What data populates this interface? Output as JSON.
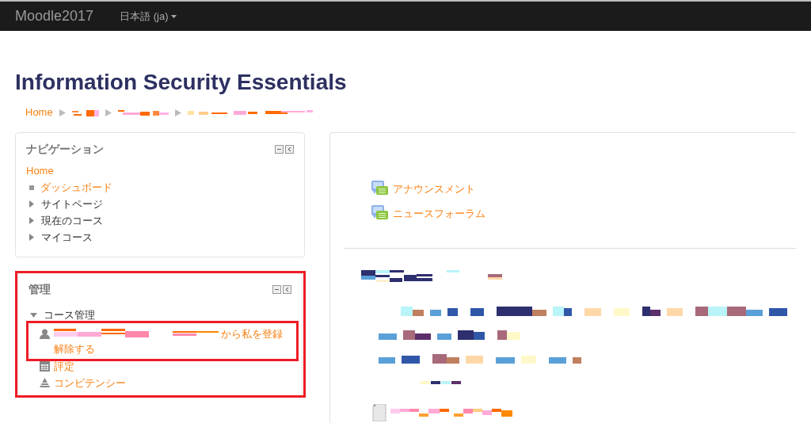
{
  "navbar": {
    "brand": "Moodle2017",
    "language": "日本語 (ja)"
  },
  "page_title": "Information Security Essentials",
  "breadcrumb": [
    {
      "kind": "link",
      "label": "Home"
    },
    {
      "kind": "redacted"
    },
    {
      "kind": "redacted"
    },
    {
      "kind": "redacted"
    }
  ],
  "navigation_block": {
    "title": "ナビゲーション",
    "items": [
      {
        "label": "Home",
        "kind": "root",
        "children": [
          {
            "label": "ダッシュボード",
            "kind": "leaf"
          },
          {
            "label": "サイトページ",
            "kind": "branch",
            "expanded": false
          },
          {
            "label": "現在のコース",
            "kind": "branch",
            "expanded": false
          },
          {
            "label": "マイコース",
            "kind": "branch",
            "expanded": false
          }
        ]
      }
    ]
  },
  "admin_block": {
    "title": "管理",
    "items": [
      {
        "label": "コース管理",
        "kind": "branch",
        "expanded": true,
        "children": [
          {
            "kind": "unenrol",
            "label": "から私を登録解除する"
          },
          {
            "kind": "grades",
            "label": "評定"
          },
          {
            "kind": "competencies",
            "label": "コンピテンシー"
          }
        ]
      }
    ]
  },
  "main": {
    "forums": [
      {
        "label": "アナウンスメント"
      },
      {
        "label": "ニュースフォーラム"
      }
    ]
  }
}
